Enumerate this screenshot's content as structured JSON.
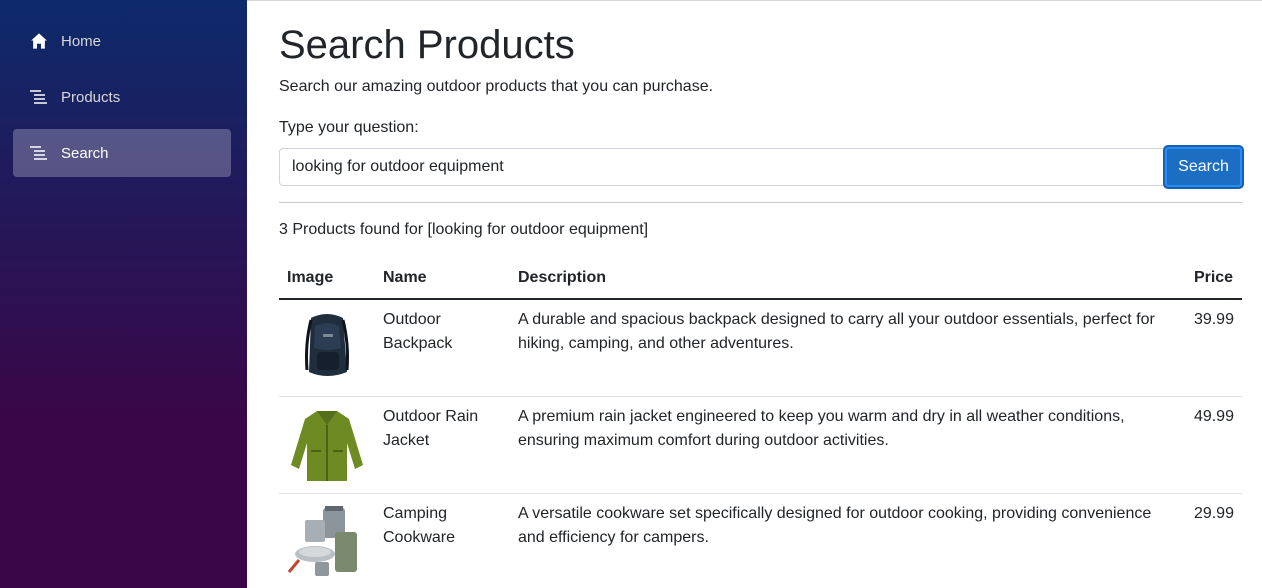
{
  "sidebar": {
    "items": [
      {
        "label": "Home",
        "icon": "home-icon"
      },
      {
        "label": "Products",
        "icon": "list-icon"
      },
      {
        "label": "Search",
        "icon": "list-icon",
        "active": true
      }
    ]
  },
  "page": {
    "title": "Search Products",
    "lead": "Search our amazing outdoor products that you can purchase.",
    "question_label": "Type your question:"
  },
  "search": {
    "value": "looking for outdoor equipment",
    "button_label": "Search"
  },
  "results": {
    "summary": "3 Products found for [looking for outdoor equipment]",
    "columns": [
      "Image",
      "Name",
      "Description",
      "Price"
    ],
    "rows": [
      {
        "image": "backpack-image",
        "name": "Outdoor Backpack",
        "description": "A durable and spacious backpack designed to carry all your outdoor essentials, perfect for hiking, camping, and other adventures.",
        "price": "39.99"
      },
      {
        "image": "rain-jacket-image",
        "name": "Outdoor Rain Jacket",
        "description": "A premium rain jacket engineered to keep you warm and dry in all weather conditions, ensuring maximum comfort during outdoor activities.",
        "price": "49.99"
      },
      {
        "image": "cookware-image",
        "name": "Camping Cookware",
        "description": "A versatile cookware set specifically designed for outdoor cooking, providing convenience and efficiency for campers.",
        "price": "29.99"
      }
    ]
  },
  "colors": {
    "sidebar_top": "#0d2a6b",
    "sidebar_bottom": "#3a0647",
    "primary_button": "#1b6ec2"
  }
}
